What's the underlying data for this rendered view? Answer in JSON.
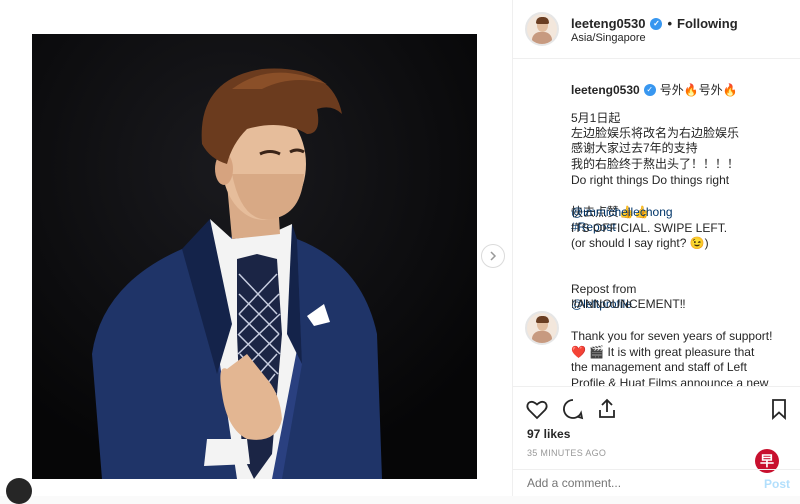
{
  "post": {
    "username": "leeteng0530",
    "following_label": "Following",
    "separator": "•",
    "location": "Asia/Singapore"
  },
  "caption": {
    "username": "leeteng0530",
    "title": "号外🔥号外🔥",
    "lines": [
      "5月1日起",
      "左边脸娱乐将改名为右边脸娱乐",
      "感谢大家过去7年的支持",
      "我的右脸终于熬出头了！！！！",
      "Do right things Do things right",
      "快去点赞👍👍"
    ],
    "hashtag": "#Repost",
    "mention": "@immichellechong",
    "line_official": "ITS OFFICIAL. SWIPE LEFT.",
    "line_question": "(or should I say right? 😉)",
    "repost_from": "Repost from",
    "repost_handle": "@leftprofile",
    "announcement": "‼ANNOUNCEMENT‼",
    "comment_text": "Thank you for seven years of support!\n❤️ 🎬 It is with great pleasure that\nthe management and staff of Left\nProfile & Huat Films announce a new"
  },
  "actions": {
    "likes": "97 likes",
    "time": "35 MINUTES AGO",
    "comment_placeholder": "Add a comment...",
    "post_label": "Post"
  },
  "watermark": "早",
  "icons": [
    "verified-badge-icon",
    "heart-icon",
    "comment-icon",
    "share-icon",
    "bookmark-icon",
    "chevron-right-icon"
  ],
  "colors": {
    "link": "#003569",
    "verified": "#3897f0",
    "post_disabled": "#b2dffc"
  }
}
